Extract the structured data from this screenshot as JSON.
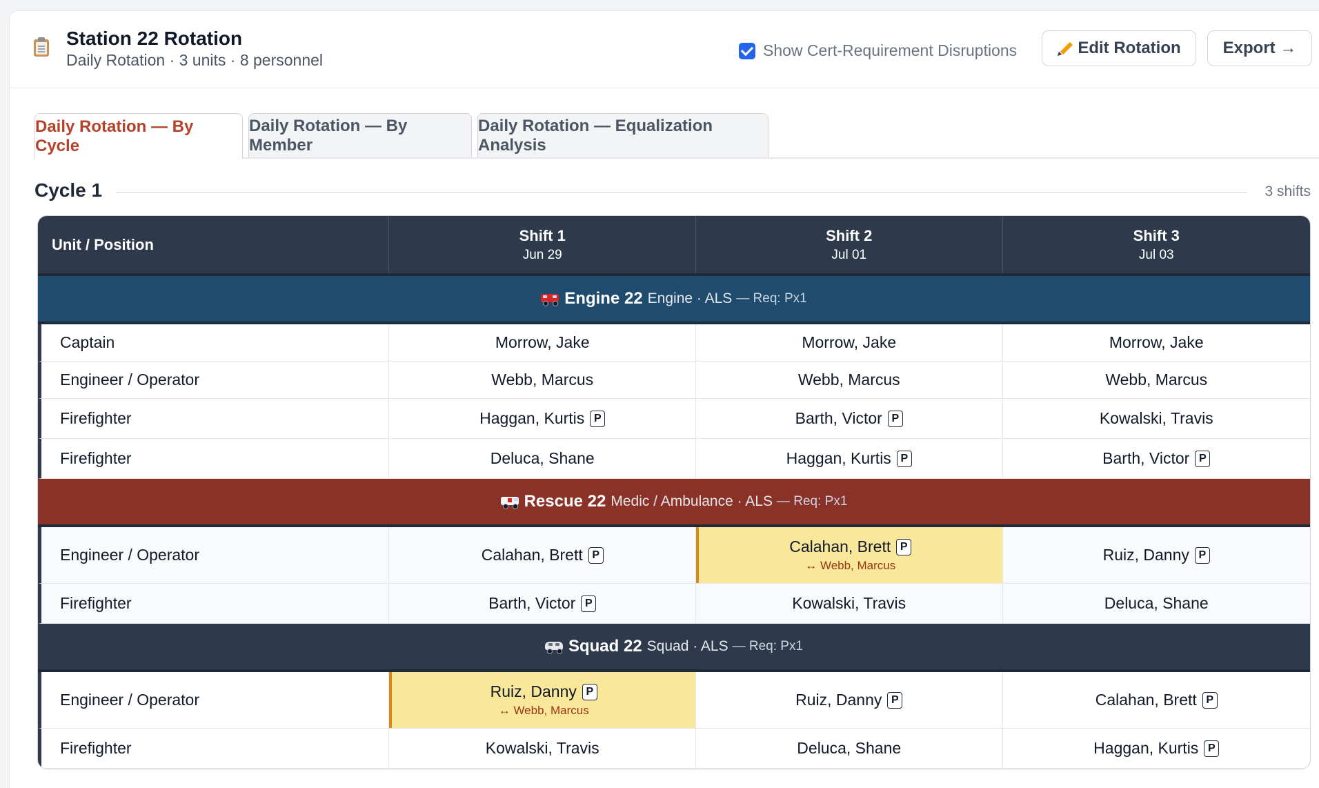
{
  "header": {
    "title": "Station 22 Rotation",
    "subtitle": "Daily Rotation · 3 units · 8 personnel",
    "toggle_label": "Show Cert-Requirement Disruptions",
    "toggle_checked": true,
    "edit_label": "Edit Rotation",
    "export_label": "Export →"
  },
  "tabs": [
    {
      "label": "Daily Rotation — By Cycle",
      "active": true
    },
    {
      "label": "Daily Rotation — By Member",
      "active": false
    },
    {
      "label": "Daily Rotation — Equalization Analysis",
      "active": false
    }
  ],
  "cycle": {
    "title": "Cycle 1",
    "count": "3 shifts"
  },
  "table": {
    "col_unit": "Unit / Position",
    "shifts": [
      {
        "name": "Shift 1",
        "date": "Jun 29"
      },
      {
        "name": "Shift 2",
        "date": "Jul 01"
      },
      {
        "name": "Shift 3",
        "date": "Jul 03"
      }
    ],
    "units": [
      {
        "name": "Engine 22",
        "type": "Engine · ALS",
        "req": "— Req: Px1",
        "icon": "fire-truck-icon",
        "rows": [
          {
            "position": "Captain",
            "cells": [
              {
                "name": "Morrow, Jake",
                "badge": ""
              },
              {
                "name": "Morrow, Jake",
                "badge": ""
              },
              {
                "name": "Morrow, Jake",
                "badge": ""
              }
            ]
          },
          {
            "position": "Engineer / Operator",
            "cells": [
              {
                "name": "Webb, Marcus",
                "badge": ""
              },
              {
                "name": "Webb, Marcus",
                "badge": ""
              },
              {
                "name": "Webb, Marcus",
                "badge": ""
              }
            ]
          },
          {
            "position": "Firefighter",
            "cells": [
              {
                "name": "Haggan, Kurtis",
                "badge": "P"
              },
              {
                "name": "Barth, Victor",
                "badge": "P"
              },
              {
                "name": "Kowalski, Travis",
                "badge": ""
              }
            ]
          },
          {
            "position": "Firefighter",
            "cells": [
              {
                "name": "Deluca, Shane",
                "badge": ""
              },
              {
                "name": "Haggan, Kurtis",
                "badge": "P"
              },
              {
                "name": "Barth, Victor",
                "badge": "P"
              }
            ]
          }
        ]
      },
      {
        "name": "Rescue 22",
        "type": "Medic / Ambulance · ALS",
        "req": "— Req: Px1",
        "icon": "ambulance-icon",
        "rows": [
          {
            "position": "Engineer / Operator",
            "cells": [
              {
                "name": "Calahan, Brett",
                "badge": "P"
              },
              {
                "name": "Calahan, Brett",
                "badge": "P",
                "swap": "↔ Webb, Marcus"
              },
              {
                "name": "Ruiz, Danny",
                "badge": "P"
              }
            ]
          },
          {
            "position": "Firefighter",
            "cells": [
              {
                "name": "Barth, Victor",
                "badge": "P"
              },
              {
                "name": "Kowalski, Travis",
                "badge": ""
              },
              {
                "name": "Deluca, Shane",
                "badge": ""
              }
            ]
          }
        ]
      },
      {
        "name": "Squad 22",
        "type": "Squad · ALS",
        "req": "— Req: Px1",
        "icon": "car-icon",
        "rows": [
          {
            "position": "Engineer / Operator",
            "cells": [
              {
                "name": "Ruiz, Danny",
                "badge": "P",
                "swap": "↔ Webb, Marcus"
              },
              {
                "name": "Ruiz, Danny",
                "badge": "P"
              },
              {
                "name": "Calahan, Brett",
                "badge": "P"
              }
            ]
          },
          {
            "position": "Firefighter",
            "cells": [
              {
                "name": "Kowalski, Travis",
                "badge": ""
              },
              {
                "name": "Deluca, Shane",
                "badge": ""
              },
              {
                "name": "Haggan, Kurtis",
                "badge": "P"
              }
            ]
          }
        ]
      }
    ]
  },
  "colors": {
    "active_tab": "#b5432c",
    "engine_band": "#1f4b6e",
    "rescue_band": "#8a3227",
    "squad_band": "#2e3a4b",
    "swap_highlight": "#f9e79a",
    "checkbox": "#2563eb"
  }
}
